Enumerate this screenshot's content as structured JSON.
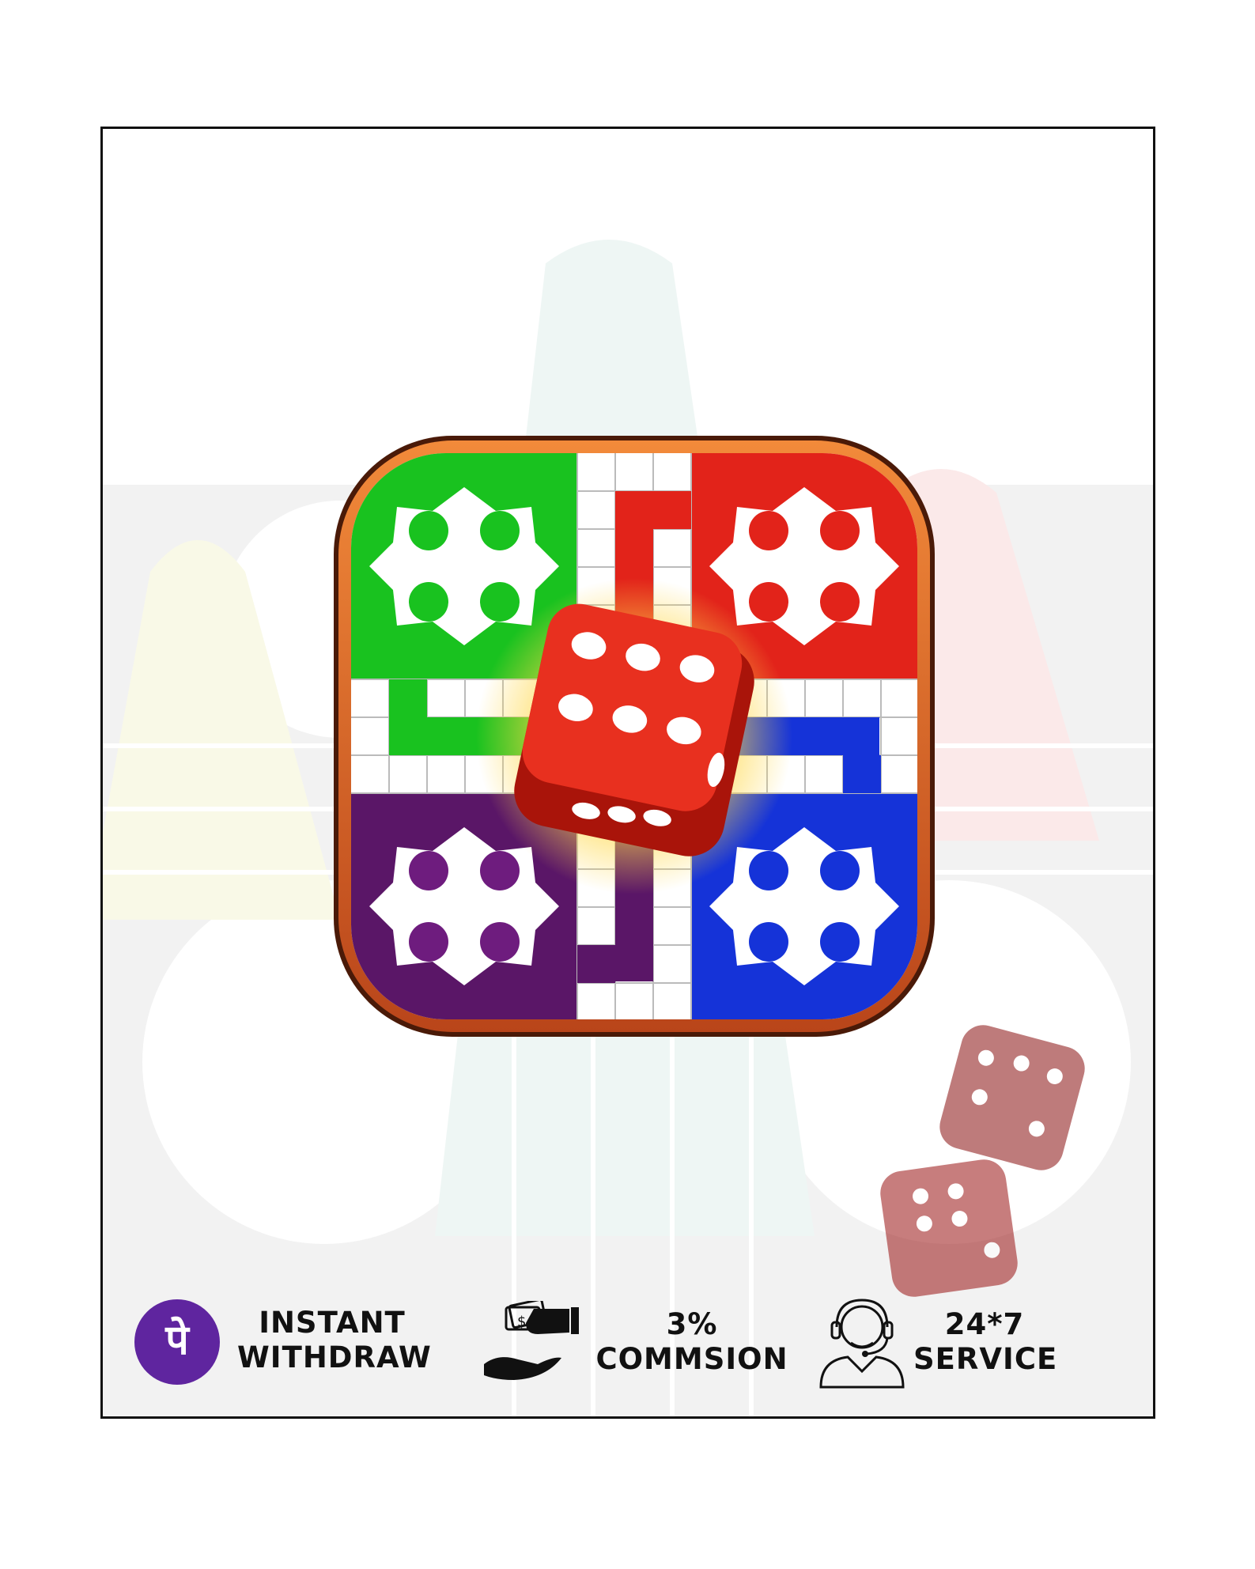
{
  "features": [
    {
      "icon": "phonepe-logo",
      "glyph": "पे",
      "line1": "INSTANT",
      "line2": "WITHDRAW",
      "accent": "#5f259f"
    },
    {
      "icon": "money-hand-icon",
      "line1": "3%",
      "line2": "COMMSION"
    },
    {
      "icon": "support-agent-icon",
      "line1": "24*7",
      "line2": "SERVICE"
    }
  ],
  "colors": {
    "green": "#19c21f",
    "red": "#e2231a",
    "purple": "#5a1667",
    "blue": "#1533d8",
    "border": "#c8531c",
    "dice": "#d81e10"
  }
}
